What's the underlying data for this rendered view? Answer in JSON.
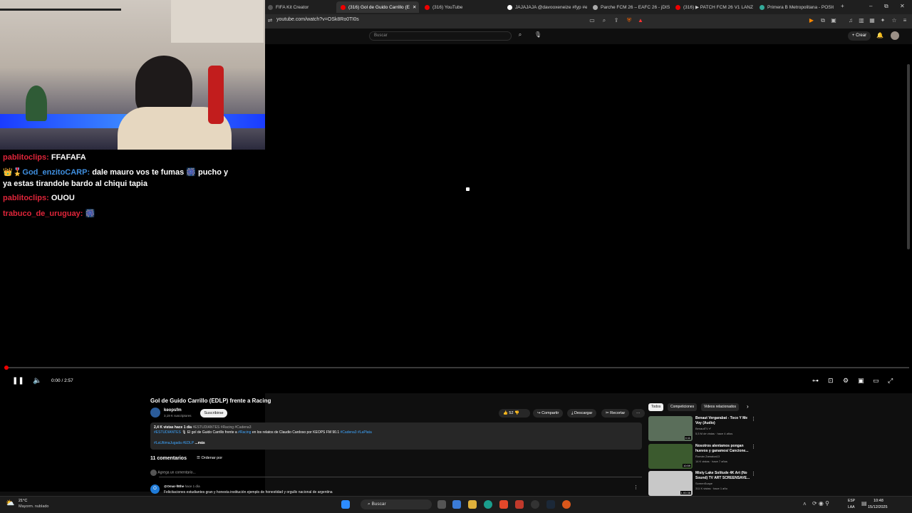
{
  "tabs": [
    {
      "label": "FIFA Kit Creator",
      "color": "#555"
    },
    {
      "label": "(316) Gol de Guido Carrillo (E",
      "color": "#e00"
    },
    {
      "label": "(316) YouTube",
      "color": "#e00"
    },
    {
      "label": "JAJAJAJA @davooxeneize #fyp #e",
      "color": "#fff"
    },
    {
      "label": "Parche FCM 26 – EAFC 26 - jDISP",
      "color": "#aaa"
    },
    {
      "label": "(316) ▶ PATCH FCM 26 V1 LANZ",
      "color": "#e00"
    },
    {
      "label": "Primera B Metropolitana - POSICIO",
      "color": "#3a9"
    }
  ],
  "window": {
    "minimize": "–",
    "maximize": "⧉",
    "close": "✕",
    "newtab": "+"
  },
  "address": {
    "url": "youtube.com/watch?v=OSk8Ro0TI0s"
  },
  "youtube": {
    "search_placeholder": "Buscar",
    "create": "+ Crear"
  },
  "chat": [
    {
      "icons": "",
      "user": "pablitoclips:",
      "msg": "FFAFAFA",
      "user_color": "red"
    },
    {
      "icons": "👑🎖️",
      "user": "God_enzitoCARP:",
      "msg": "dale mauro vos te fumas 🎆 pucho y ya estas tirandole bardo al chiqui tapia",
      "user_color": "blue"
    },
    {
      "icons": "",
      "user": "pablitoclips:",
      "msg": "OUOU",
      "user_color": "red"
    },
    {
      "icons": "",
      "user": "trabuco_de_uruguay:",
      "msg": "🎆",
      "user_color": "red"
    }
  ],
  "player": {
    "time": "0:00 / 2:57",
    "progress": 0
  },
  "video": {
    "title": "Gol de Guido Carrillo (EDLP) frente a Racing",
    "channel": "keopsfm",
    "subs": "3,19 K suscriptores",
    "subscribe": "Suscribirse",
    "likes": "52",
    "share": "Compartir",
    "download": "Descargar",
    "clip": "Recortar",
    "more": "···"
  },
  "description": {
    "stats": "2,4 K vistas  hace 1 día",
    "tags_inline": "#ESTUDIANTES #Racing #Cadena3",
    "line2_tag": "#ESTUDIANTES",
    "line2_a": "🎙 El gol de Guido Carrillo frente a",
    "line2_racing": "#Racing",
    "line2_b": "en los relatos de Claudio Cardoso por KEOPS FM 90.1",
    "line2_tags": "#Cadena3 #LaPlata",
    "line3_tags": "#LaUltimaJugada #EDLP",
    "more": "...más"
  },
  "comments": {
    "count": "11 comentarios",
    "sort": "Ordenar por",
    "add": "Agrega un comentario...",
    "first_user": "@Omar-f8the",
    "first_time": "hace 1 día",
    "first_text": "Felicitaciones estudiantes gran y honesta institución ejemplo de honestidad y orgullo nacional de argentina",
    "first_avatar": "O"
  },
  "chips": [
    "Todos",
    "Competiciones",
    "Videos relacionados"
  ],
  "recommended": [
    {
      "title": "Benaut Vergarabat - Toco Y Me Voy (Audio)",
      "channel": "BenautTV ✔",
      "meta": "5,5 M de vistas · hace 4 años",
      "duration": "4:11",
      "color": "#5a6e5a"
    },
    {
      "title": "Nosotros alentamos pongan huevos y ganamos/ Cancione...",
      "channel": "Román Zamaloa13",
      "meta": "14 K vistas · hace 7 años",
      "duration": "10:59",
      "color": "#3b5a2e"
    },
    {
      "title": "Misty Lake Solitude 4K Art (No Sound) TV ART SCREENSAVE...",
      "channel": "ScreenScape",
      "meta": "311 K vistas · hace 1 año",
      "duration": "1:00:38",
      "color": "#c8c8c8"
    }
  ],
  "taskbar": {
    "temp": "21°C",
    "weather": "Mayorm. nublado",
    "search": "Buscar",
    "lang1": "ESP",
    "lang2": "LAA",
    "time": "10:48",
    "date": "15/12/2025"
  }
}
